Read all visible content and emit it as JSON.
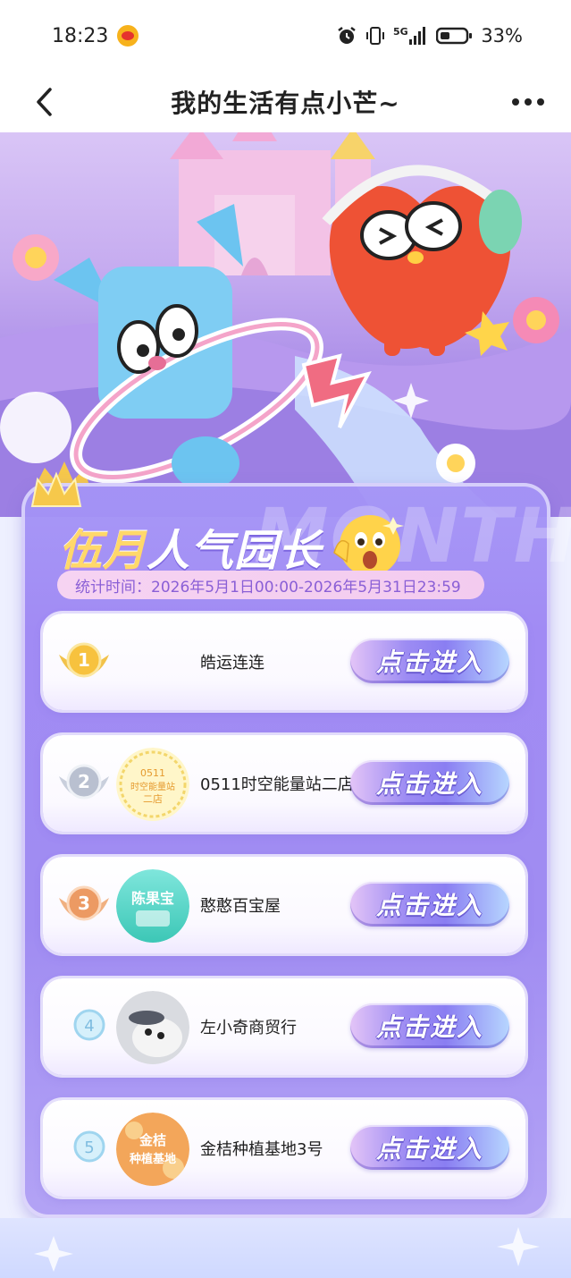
{
  "status_bar": {
    "time": "18:23",
    "battery": "33%",
    "network": "5G",
    "icons": [
      "weibo-icon",
      "alarm-icon",
      "vibrate-icon",
      "signal-icon",
      "battery-icon"
    ]
  },
  "nav": {
    "title": "我的生活有点小芒~",
    "back_icon": "chevron-left-icon",
    "more_icon": "more-dots-icon"
  },
  "board": {
    "bg_word": "MONTH",
    "title_highlight": "伍月",
    "title_rest": "人气园长",
    "stat_time": "统计时间：2026年5月1日00:00-2026年5月31日23:59"
  },
  "ranks": [
    {
      "rank": "1",
      "name": "皓运连连",
      "button": "点击进入",
      "avatar": null
    },
    {
      "rank": "2",
      "name": "0511时空能量站二店",
      "button": "点击进入",
      "avatar": "0511时空能量站二店"
    },
    {
      "rank": "3",
      "name": "憨憨百宝屋",
      "button": "点击进入",
      "avatar": "陈果宝"
    },
    {
      "rank": "4",
      "name": "左小奇商贸行",
      "button": "点击进入",
      "avatar": "photo"
    },
    {
      "rank": "5",
      "name": "金桔种植基地3号",
      "button": "点击进入",
      "avatar": "金桔种植基地"
    }
  ],
  "colors": {
    "board": "#a18bf4",
    "button": "#8a7ef2",
    "title_gold": "#ffd86a",
    "stat_text": "#8a5fd6"
  }
}
